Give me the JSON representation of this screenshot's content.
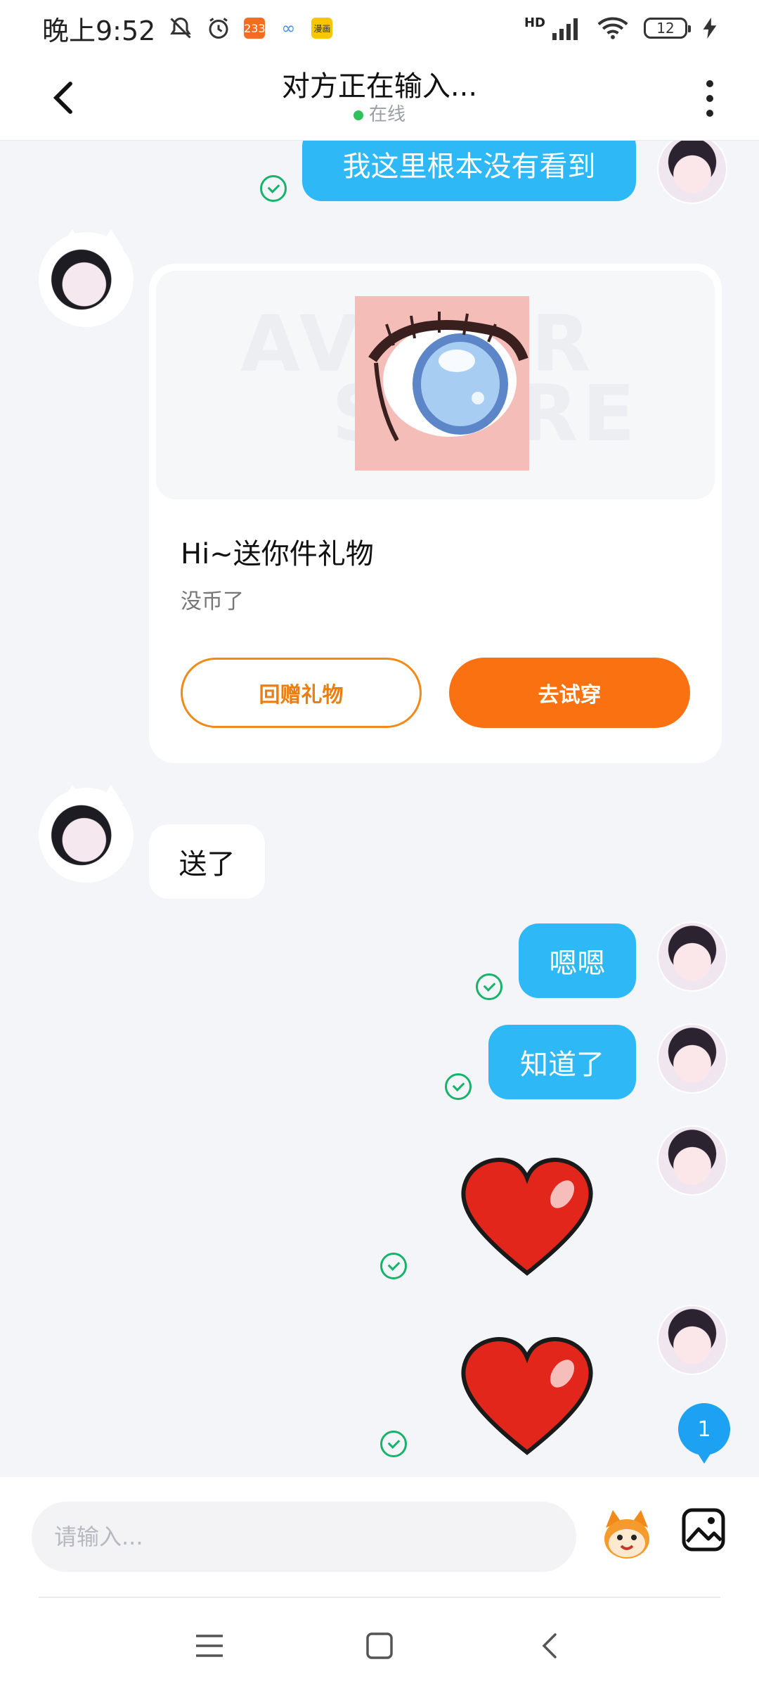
{
  "status_bar": {
    "time": "晚上9:52",
    "signal_label": "HD",
    "battery": "12",
    "app_badges": [
      {
        "label": "233",
        "color": "#f36c21"
      },
      {
        "label": "∞",
        "color": "#4a90e2"
      },
      {
        "label": "漫画",
        "color": "#f7c600"
      }
    ]
  },
  "header": {
    "title": "对方正在输入...",
    "status": "在线"
  },
  "messages": {
    "m1": "我这里根本没有看到",
    "gift": {
      "watermark_top": "AVATAR",
      "watermark_bottom": "STORE",
      "title": "Hi~送你件礼物",
      "subtitle": "没币了",
      "return_gift": "回赠礼物",
      "try_on": "去试穿"
    },
    "m2": "送了",
    "m3": "嗯嗯",
    "m4": "知道了"
  },
  "unread_count": "1",
  "input": {
    "placeholder": "请输入..."
  },
  "colors": {
    "bubble_blue": "#2eb8f5",
    "accent_orange": "#fa7112",
    "read_green": "#17b36b",
    "online_green": "#2fc15b"
  }
}
